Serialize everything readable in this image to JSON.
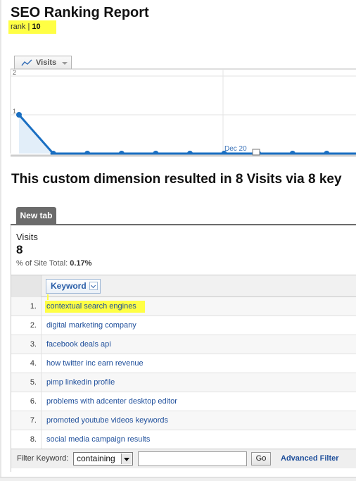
{
  "report": {
    "title": "SEO Ranking Report",
    "rank_label": "rank |",
    "rank_value": "10"
  },
  "metric_dropdown": {
    "label": "Visits",
    "icon": "sparkline-icon"
  },
  "chart_data": {
    "type": "line",
    "title": "",
    "xlabel": "",
    "ylabel": "",
    "ylim": [
      0,
      2
    ],
    "yticks": [
      "2",
      "1"
    ],
    "x_annotation": "Dec 20",
    "series": [
      {
        "values": [
          1,
          0,
          0,
          0,
          0,
          0,
          0,
          0,
          0,
          0,
          0
        ]
      }
    ],
    "grid": true,
    "color": "#1a6fc2"
  },
  "heading": "This custom dimension resulted in 8 Visits via 8 key",
  "tabs": [
    {
      "label": "New tab"
    }
  ],
  "summary": {
    "label": "Visits",
    "value": "8",
    "pct_label": "% of Site Total:",
    "pct_value": "0.17%"
  },
  "table": {
    "column_header": "Keyword",
    "rows": [
      {
        "num": "1.",
        "keyword": "contextual search engines"
      },
      {
        "num": "2.",
        "keyword": "digital marketing company"
      },
      {
        "num": "3.",
        "keyword": "facebook deals api"
      },
      {
        "num": "4.",
        "keyword": "how twitter inc earn revenue"
      },
      {
        "num": "5.",
        "keyword": "pimp linkedin profile"
      },
      {
        "num": "6.",
        "keyword": "problems with adcenter desktop editor"
      },
      {
        "num": "7.",
        "keyword": "promoted youtube videos keywords"
      },
      {
        "num": "8.",
        "keyword": "social media campaign results"
      }
    ]
  },
  "filter": {
    "label": "Filter Keyword:",
    "select_value": "containing",
    "input_value": "",
    "go_label": "Go",
    "advanced_label": "Advanced Filter"
  },
  "colors": {
    "highlight": "#ffff44",
    "link": "#1f4f9b",
    "series": "#1a6fc2",
    "tab": "#6b6b6b"
  }
}
